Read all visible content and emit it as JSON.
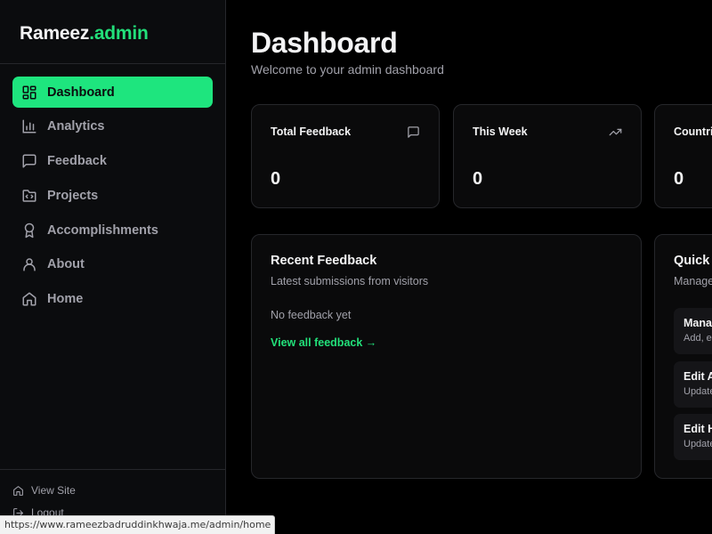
{
  "brand": {
    "name": "Rameez",
    "accent": ".admin",
    "accent_color": "#22e07a"
  },
  "nav": {
    "items": [
      {
        "label": "Dashboard",
        "icon": "layout-grid-icon",
        "active": true
      },
      {
        "label": "Analytics",
        "icon": "bar-chart-icon",
        "active": false
      },
      {
        "label": "Feedback",
        "icon": "message-square-icon",
        "active": false
      },
      {
        "label": "Projects",
        "icon": "folder-code-icon",
        "active": false
      },
      {
        "label": "Accomplishments",
        "icon": "award-icon",
        "active": false
      },
      {
        "label": "About",
        "icon": "user-icon",
        "active": false
      },
      {
        "label": "Home",
        "icon": "home-icon",
        "active": false
      }
    ]
  },
  "sidebar_footer": {
    "view_site": "View Site",
    "logout": "Logout"
  },
  "header": {
    "title": "Dashboard",
    "subtitle": "Welcome to your admin dashboard"
  },
  "stats": [
    {
      "label": "Total Feedback",
      "value": "0",
      "icon": "message-square-icon"
    },
    {
      "label": "This Week",
      "value": "0",
      "icon": "trending-up-icon"
    },
    {
      "label": "Countrie",
      "value": "0"
    }
  ],
  "recent_feedback": {
    "title": "Recent Feedback",
    "subtitle": "Latest submissions from visitors",
    "empty": "No feedback yet",
    "view_all": "View all feedback →"
  },
  "quick_actions": {
    "title": "Quick A",
    "subtitle": "Manage",
    "items": [
      {
        "title": "Manag",
        "desc": "Add, ed"
      },
      {
        "title": "Edit A",
        "desc": "Update"
      },
      {
        "title": "Edit H",
        "desc": "Update"
      }
    ]
  },
  "status_bar": {
    "url": "https://www.rameezbadruddinkhwaja.me/admin/home"
  },
  "colors": {
    "accent": "#1ee57e",
    "background": "#000000",
    "sidebar": "#0b0c0e",
    "border": "#26272b",
    "muted_text": "#a1a1aa"
  }
}
